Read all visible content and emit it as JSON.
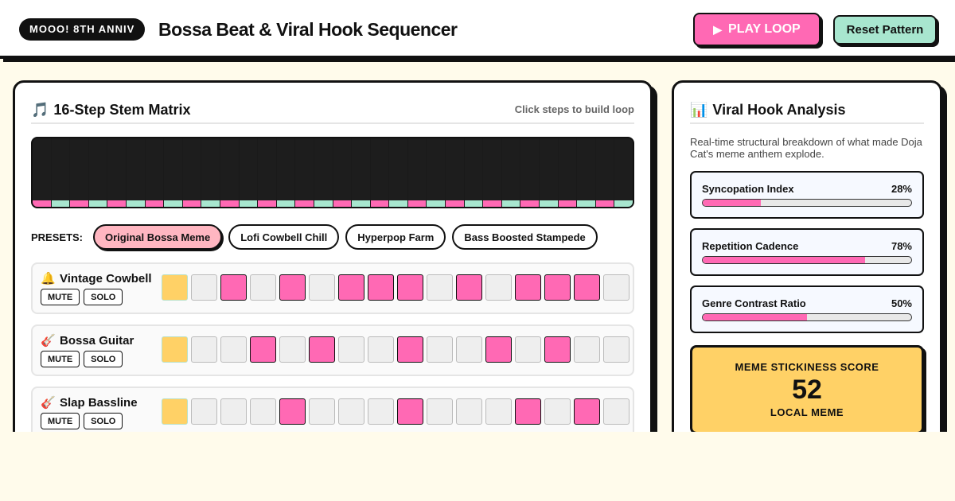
{
  "header": {
    "badge": "MOOO! 8TH ANNIV",
    "title": "Bossa Beat & Viral Hook Sequencer",
    "play_label": "PLAY LOOP",
    "reset_label": "Reset Pattern"
  },
  "matrix": {
    "icon": "🎵",
    "title": "16-Step Stem Matrix",
    "hint": "Click steps to build loop",
    "visualizer_colors": [
      "#ff69b4",
      "#a8e6cf"
    ],
    "presets_label": "PRESETS:",
    "presets": [
      {
        "label": "Original Bossa Meme",
        "active": true
      },
      {
        "label": "Lofi Cowbell Chill",
        "active": false
      },
      {
        "label": "Hyperpop Farm",
        "active": false
      },
      {
        "label": "Bass Boosted Stampede",
        "active": false
      }
    ],
    "tracks": [
      {
        "icon": "🔔",
        "name": "Vintage Cowbell",
        "mute": "MUTE",
        "solo": "SOLO",
        "steps": [
          1,
          0,
          1,
          0,
          1,
          0,
          1,
          1,
          1,
          0,
          1,
          0,
          1,
          1,
          1,
          0
        ]
      },
      {
        "icon": "🎸",
        "name": "Bossa Guitar",
        "mute": "MUTE",
        "solo": "SOLO",
        "steps": [
          1,
          0,
          0,
          1,
          0,
          1,
          0,
          0,
          1,
          0,
          0,
          1,
          0,
          1,
          0,
          0
        ]
      },
      {
        "icon": "🎸",
        "name": "Slap Bassline",
        "mute": "MUTE",
        "solo": "SOLO",
        "steps": [
          1,
          0,
          0,
          0,
          1,
          0,
          0,
          0,
          1,
          0,
          0,
          0,
          1,
          0,
          1,
          0
        ]
      }
    ],
    "current_step": 1
  },
  "analysis": {
    "icon": "📊",
    "title": "Viral Hook Analysis",
    "description": "Real-time structural breakdown of what made Doja Cat's meme anthem explode.",
    "metrics": [
      {
        "name": "Syncopation Index",
        "value": "28%",
        "percent": 28
      },
      {
        "name": "Repetition Cadence",
        "value": "78%",
        "percent": 78
      },
      {
        "name": "Genre Contrast Ratio",
        "value": "50%",
        "percent": 50
      }
    ],
    "score": {
      "label": "MEME STICKINESS SCORE",
      "value": "52",
      "tier": "LOCAL MEME"
    }
  }
}
